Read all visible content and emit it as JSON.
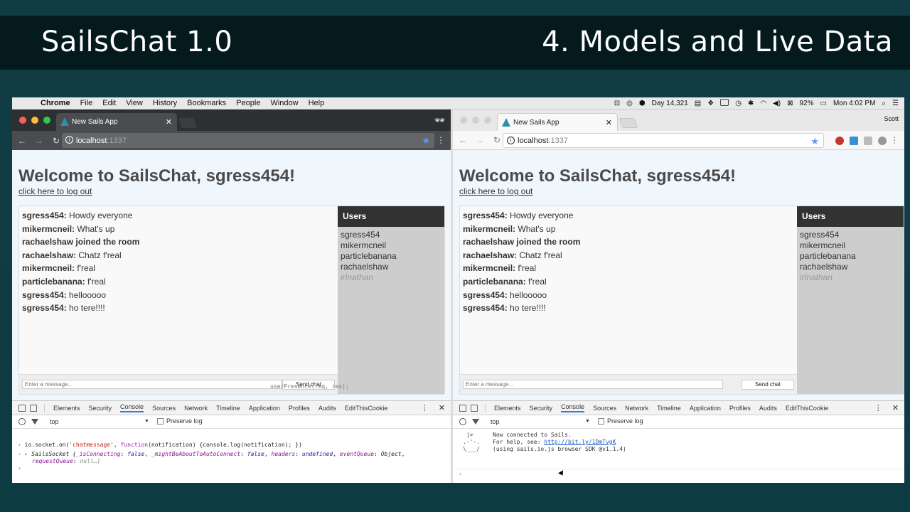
{
  "slide": {
    "title_left": "SailsChat 1.0",
    "title_right": "4. Models and Live Data"
  },
  "mac_menubar": {
    "app": "Chrome",
    "items": [
      "File",
      "Edit",
      "View",
      "History",
      "Bookmarks",
      "People",
      "Window",
      "Help"
    ],
    "day_counter": "Day 14,321",
    "battery": "92%",
    "clock": "Mon 4:02 PM"
  },
  "browsers": [
    {
      "mode": "incognito",
      "tab_title": "New Sails App",
      "url_host": "localhost",
      "url_port": ":1337"
    },
    {
      "mode": "normal",
      "profile": "Scott",
      "tab_title": "New Sails App",
      "url_host": "localhost",
      "url_port": ":1337"
    }
  ],
  "app": {
    "heading": "Welcome to SailsChat, sgress454!",
    "logout_link": "click here to log out",
    "messages": [
      {
        "user": "sgress454:",
        "text": " Howdy everyone"
      },
      {
        "user": "mikermcneil:",
        "text": " What's up"
      },
      {
        "user": "rachaelshaw joined the room",
        "text": ""
      },
      {
        "user": "rachaelshaw:",
        "text": " Chatz f'real"
      },
      {
        "user": "mikermcneil:",
        "text": " f'real"
      },
      {
        "user": "particlebanana:",
        "text": " f'real"
      },
      {
        "user": "sgress454:",
        "text": " hellooooo"
      },
      {
        "user": "sgress454:",
        "text": " ho tere!!!!"
      }
    ],
    "users_heading": "Users",
    "users_online": [
      "sgress454",
      "mikermcneil",
      "particlebanana",
      "rachaelshaw"
    ],
    "users_away": [
      "irlnathan"
    ],
    "input_placeholder": "Enter a message...",
    "send_label": "Send chat"
  },
  "devtools": {
    "tabs": [
      "Elements",
      "Security",
      "Console",
      "Sources",
      "Network",
      "Timeline",
      "Application",
      "Profiles",
      "Audits",
      "EditThisCookie"
    ],
    "active_tab": "Console",
    "context": "top",
    "preserve_log": "Preserve log",
    "left_console": {
      "input_prefix": "io.socket.on(",
      "input_event": "'chatmessage'",
      "input_suffix_1": ", ",
      "input_function": "function",
      "input_suffix_2": "(notification) {console.log(notification); })",
      "output_class": "SailsSocket {",
      "output_pairs": [
        {
          "k": "_isConnecting",
          "v": "false"
        },
        {
          "k": "_mightBeAboutToAutoConnect",
          "v": "false"
        },
        {
          "k": "headers",
          "v": "undefined"
        },
        {
          "k": "eventQueue",
          "v": "Object"
        }
      ],
      "output_line2_key": "requestQueue",
      "output_line2_val": "null…}"
    },
    "right_console": {
      "ascii_art": " |>\n.-'-.\n\\___/",
      "line1": "Now connected to Sails.",
      "line2_prefix": "For help, see: ",
      "line2_link": "http://bit.ly/1DmTvgK",
      "line3": "(using sails.io.js browser SDK @v1.1.4)"
    }
  },
  "background_snippet": "userPresence(req, res);"
}
